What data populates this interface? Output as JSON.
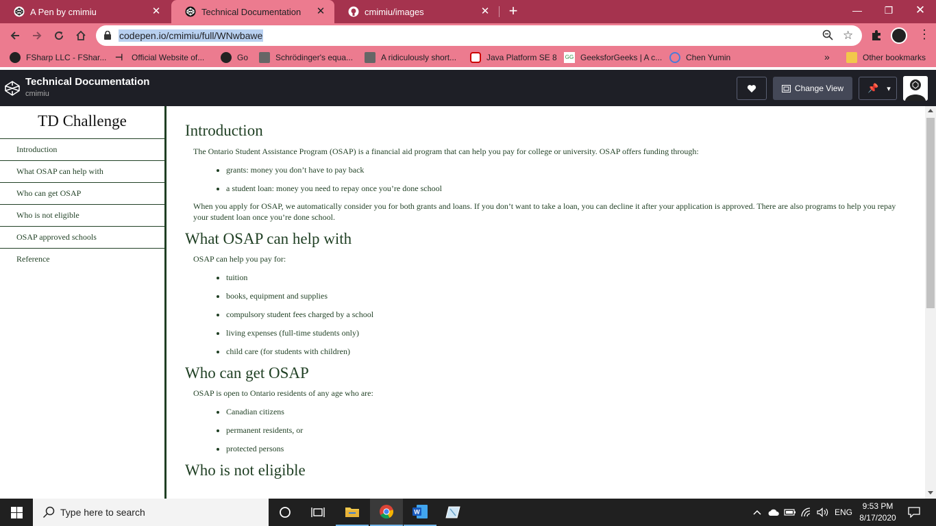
{
  "browser": {
    "tabs": [
      {
        "title": "A Pen by cmimiu",
        "active": false
      },
      {
        "title": "Technical Documentation",
        "active": true
      },
      {
        "title": "cmimiu/images",
        "active": false
      }
    ],
    "url": "codepen.io/cmimiu/full/WNwbawe",
    "bookmarks": [
      "FSharp LLC - FShar...",
      "Official Website of...",
      "Go",
      "Schrödinger's equa...",
      "A ridiculously short...",
      "Java Platform SE 8",
      "GeeksforGeeks | A c...",
      "Chen Yumin"
    ],
    "other_bookmarks": "Other bookmarks",
    "colors": {
      "tabstrip": "#a5334e",
      "toolbar": "#ec7b8f"
    }
  },
  "codepen": {
    "title": "Technical Documentation",
    "user": "cmimiu",
    "change_view": "Change View"
  },
  "nav": {
    "header": "TD Challenge",
    "links": [
      "Introduction",
      "What OSAP can help with",
      "Who can get OSAP",
      "Who is not eligible",
      "OSAP approved schools",
      "Reference"
    ]
  },
  "sections": {
    "intro": {
      "title": "Introduction",
      "p1": "The Ontario Student Assistance Program (OSAP) is a financial aid program that can help you pay for college or university. OSAP offers funding through:",
      "items": [
        "grants: money you don’t have to pay back",
        "a student loan: money you need to repay once you’re done school"
      ],
      "p2": "When you apply for OSAP, we automatically consider you for both grants and loans. If you don’t want to take a loan, you can decline it after your application is approved. There are also programs to help you repay your student loan once you’re done school."
    },
    "help": {
      "title": "What OSAP can help with",
      "p1": "OSAP can help you pay for:",
      "items": [
        "tuition",
        "books, equipment and supplies",
        "compulsory student fees charged by a school",
        "living expenses (full-time students only)",
        "child care (for students with children)"
      ]
    },
    "who": {
      "title": "Who can get OSAP",
      "p1": "OSAP is open to Ontario residents of any age who are:",
      "items": [
        "Canadian citizens",
        "permanent residents, or",
        "protected persons"
      ]
    },
    "noteligible": {
      "title": "Who is not eligible"
    }
  },
  "taskbar": {
    "search_placeholder": "Type here to search",
    "language": "ENG",
    "time": "9:53 PM",
    "date": "8/17/2020"
  }
}
